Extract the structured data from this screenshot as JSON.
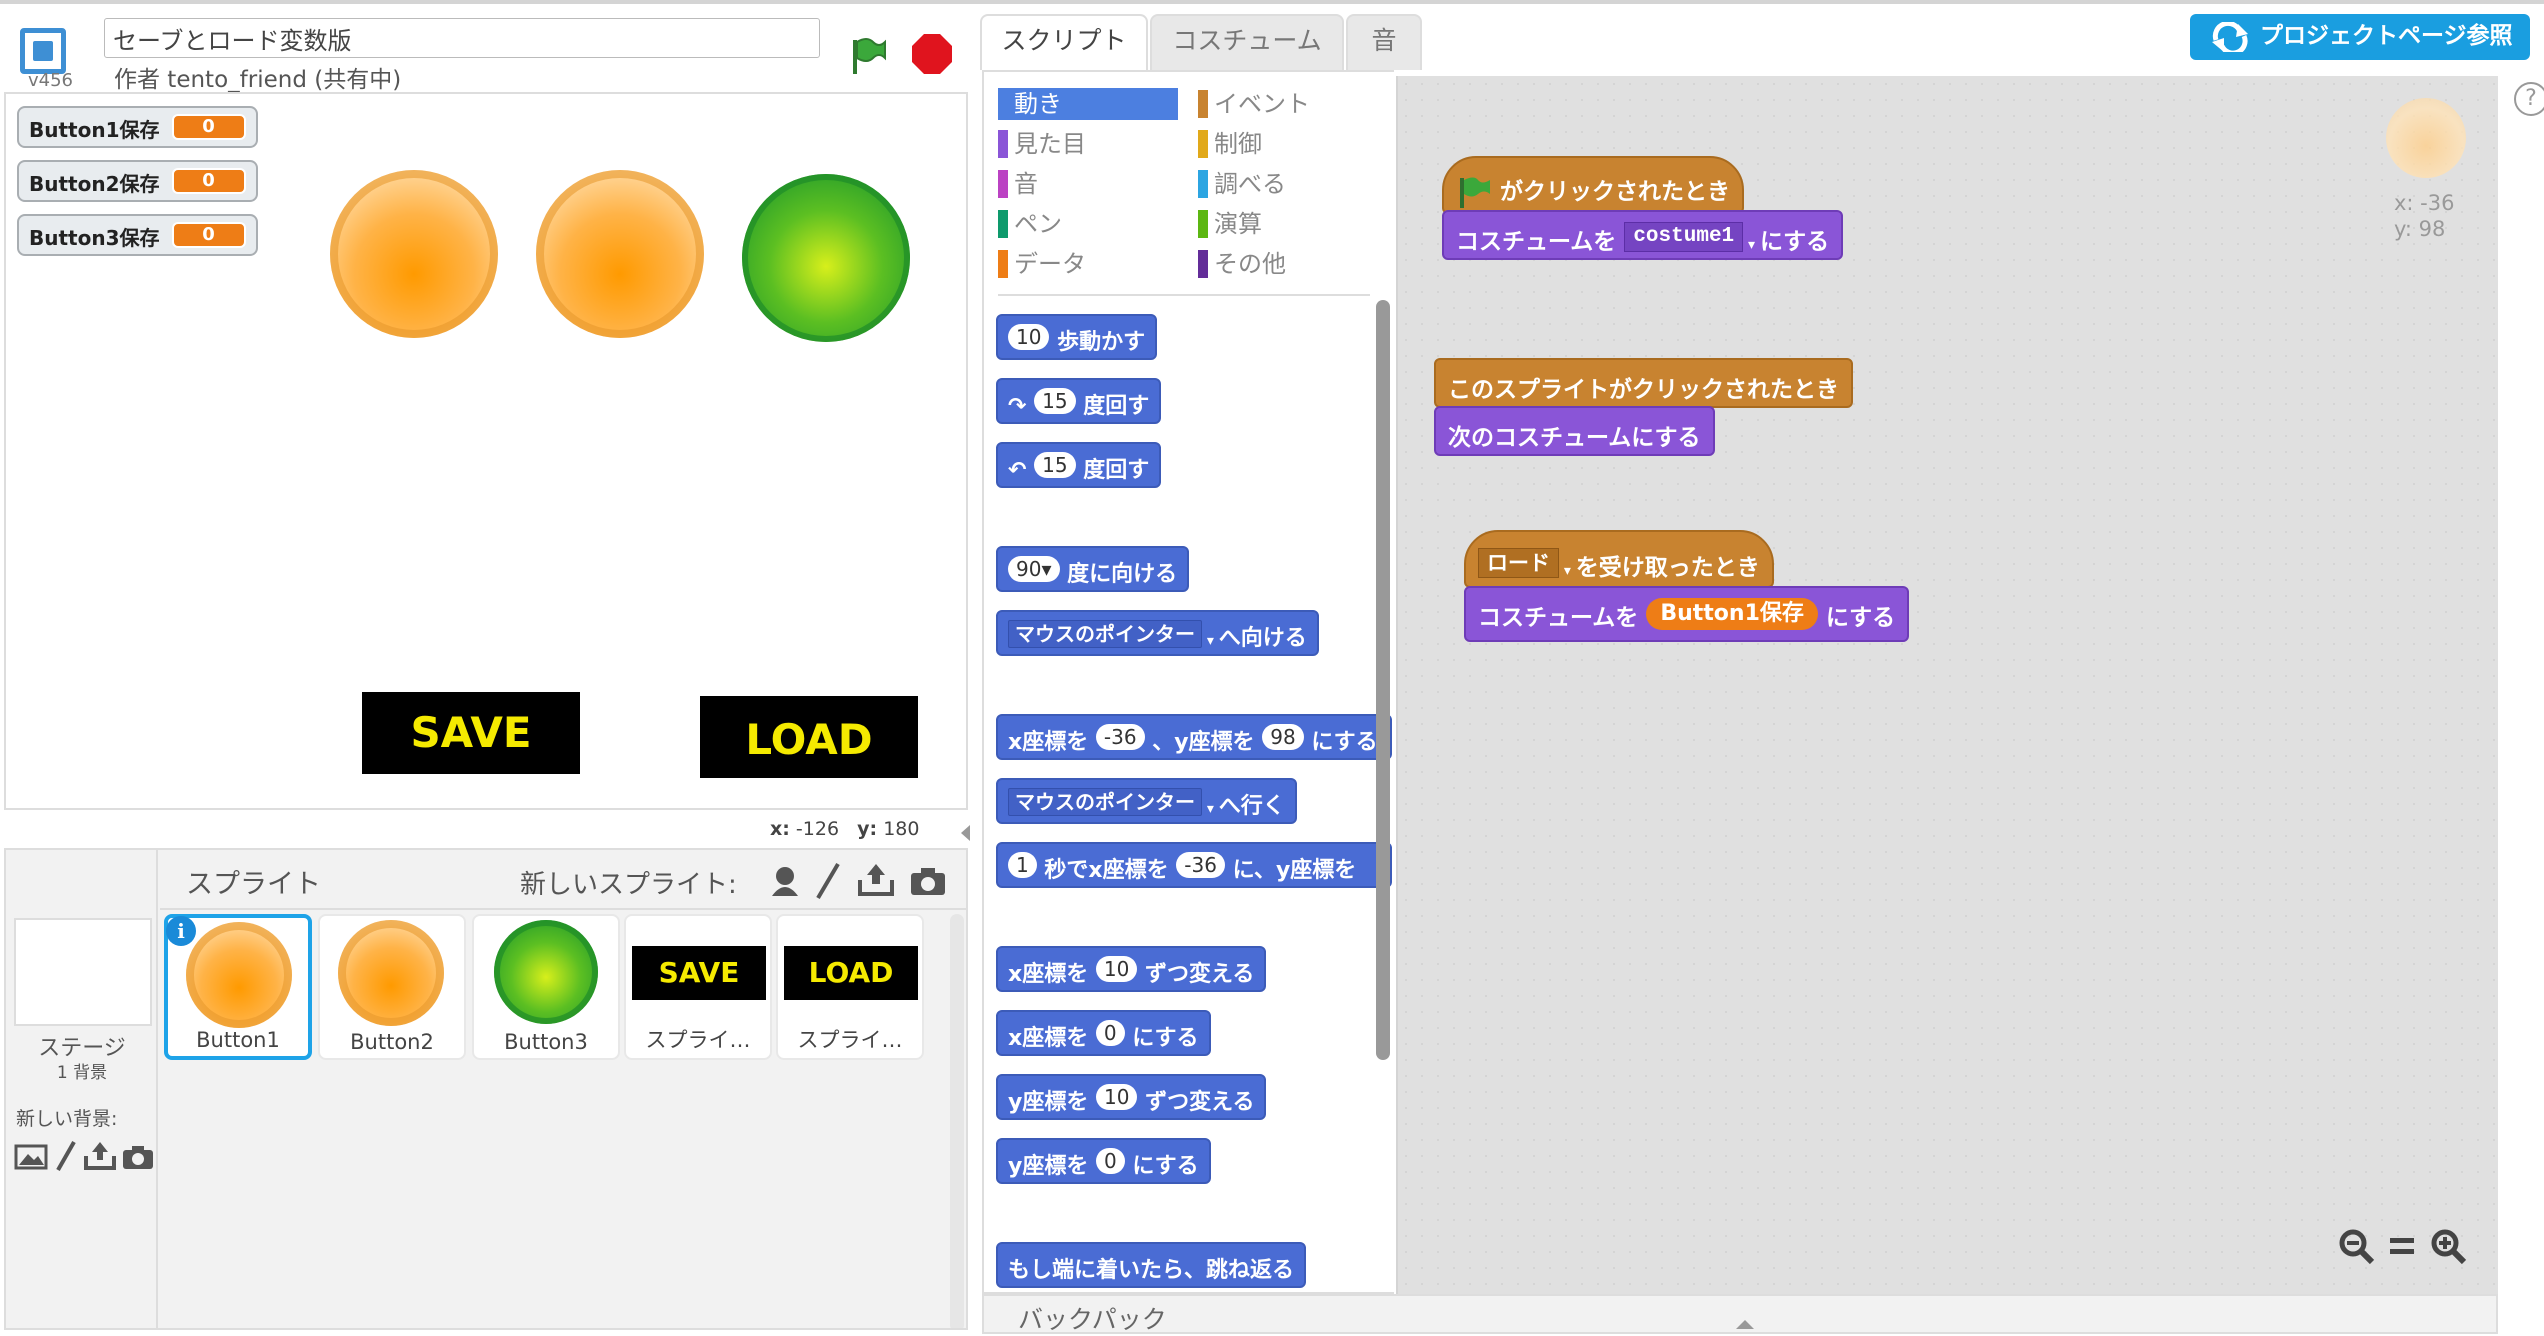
{
  "header": {
    "version": "v456",
    "title_value": "セーブとロード変数版",
    "author": "作者 tento_friend (共有中)"
  },
  "stage": {
    "monitors": [
      {
        "label": "Button1保存",
        "value": "0"
      },
      {
        "label": "Button2保存",
        "value": "0"
      },
      {
        "label": "Button3保存",
        "value": "0"
      }
    ],
    "save_label": "SAVE",
    "load_label": "LOAD",
    "mouse_x_label": "x:",
    "mouse_x": "-126",
    "mouse_y_label": "y:",
    "mouse_y": "180"
  },
  "sprites_pane": {
    "title": "スプライト",
    "new_sprite_label": "新しいスプライト:",
    "stage_label": "ステージ",
    "stage_backdrops": "1 背景",
    "new_backdrop_label": "新しい背景:",
    "sprites": [
      {
        "name": "Button1",
        "kind": "orange",
        "selected": true
      },
      {
        "name": "Button2",
        "kind": "orange",
        "selected": false
      },
      {
        "name": "Button3",
        "kind": "green",
        "selected": false
      },
      {
        "name": "スプライ…",
        "kind": "save",
        "thumb_text": "SAVE",
        "selected": false
      },
      {
        "name": "スプライ…",
        "kind": "load",
        "thumb_text": "LOAD",
        "selected": false
      }
    ]
  },
  "tabs": [
    "スクリプト",
    "コスチューム",
    "音"
  ],
  "project_page_button": "プロジェクトページ参照",
  "palette": {
    "categories": [
      {
        "label": "動き",
        "color": "#4a6cd4",
        "active": true
      },
      {
        "label": "イベント",
        "color": "#c88330"
      },
      {
        "label": "見た目",
        "color": "#8a55d7"
      },
      {
        "label": "制御",
        "color": "#e1a91a"
      },
      {
        "label": "音",
        "color": "#bb42c3"
      },
      {
        "label": "調べる",
        "color": "#2ca5e2"
      },
      {
        "label": "ペン",
        "color": "#0e9a6c"
      },
      {
        "label": "演算",
        "color": "#5cb712"
      },
      {
        "label": "データ",
        "color": "#ee7d16"
      },
      {
        "label": "その他",
        "color": "#632d99"
      }
    ],
    "blocks": {
      "move_steps": "10",
      "move_label": "歩動かす",
      "turn_cw_deg": "15",
      "turn_label": "度回す",
      "turn_ccw_deg": "15",
      "point_dir": "90▾",
      "point_dir_label": "度に向ける",
      "point_towards_dd": "マウスのポインター",
      "point_towards_label": "へ向ける",
      "goto_x_label": "x座標を",
      "goto_x": "-36",
      "goto_y_label": "、y座標を",
      "goto_y": "98",
      "goto_suffix": "にする",
      "goto_dd": "マウスのポインター",
      "goto_label": "へ行く",
      "glide_secs": "1",
      "glide_label1": "秒でx座標を",
      "glide_x": "-36",
      "glide_label2": "に、y座標を",
      "change_x_label": "x座標を",
      "change_x": "10",
      "change_x_suffix": "ずつ変える",
      "set_x_label": "x座標を",
      "set_x": "0",
      "set_x_suffix": "にする",
      "change_y_label": "y座標を",
      "change_y": "10",
      "change_y_suffix": "ずつ変える",
      "set_y_label": "y座標を",
      "set_y": "0",
      "set_y_suffix": "にする",
      "bounce_label": "もし端に着いたら、跳ね返る"
    }
  },
  "scripts": {
    "s1_hat": "がクリックされたとき",
    "s1_cmd_prefix": "コスチュームを",
    "s1_costume": "costume1",
    "s1_cmd_suffix": "にする",
    "s2_hat": "このスプライトがクリックされたとき",
    "s2_cmd": "次のコスチュームにする",
    "s3_message": "ロード",
    "s3_hat_suffix": "を受け取ったとき",
    "s3_cmd_prefix": "コスチュームを",
    "s3_var": "Button1保存",
    "s3_cmd_suffix": "にする",
    "sprite_x": "x: -36",
    "sprite_y": "y: 98"
  },
  "backpack_label": "バックパック",
  "colors": {
    "motion": "#4a6cd4",
    "events": "#c88330",
    "looks": "#8a55d7",
    "data": "#ee7d16",
    "accent": "#1a9ee0"
  }
}
